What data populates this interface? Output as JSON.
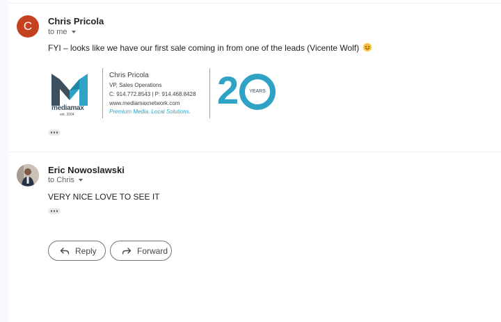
{
  "messages": [
    {
      "avatar_letter": "C",
      "sender": "Chris Pricola",
      "to": "to me",
      "body": "FYI – looks like we have our first sale coming in from one of the leads (Vicente Wolf)",
      "signature": {
        "logo_text": "mediamax",
        "logo_est": "est. 2004",
        "name": "Chris Pricola",
        "title": "VP, Sales Operations",
        "phones": "C: 914.772.8543 | P: 914.468.8428",
        "website": "www.mediamaxnetwork.com",
        "tagline": "Premium Media. Local Solutions.",
        "anniversary_number": "20",
        "anniversary_word": "YEARS"
      }
    },
    {
      "sender": "Eric Nowoslawski",
      "to": "to Chris",
      "body": "VERY NICE LOVE TO SEE IT"
    }
  ],
  "actions": {
    "reply_label": "Reply",
    "forward_label": "Forward"
  },
  "colors": {
    "avatar_c": "#c5411f",
    "brand_blue": "#2fa3c6",
    "logo_dark": "#3d4f5c"
  }
}
